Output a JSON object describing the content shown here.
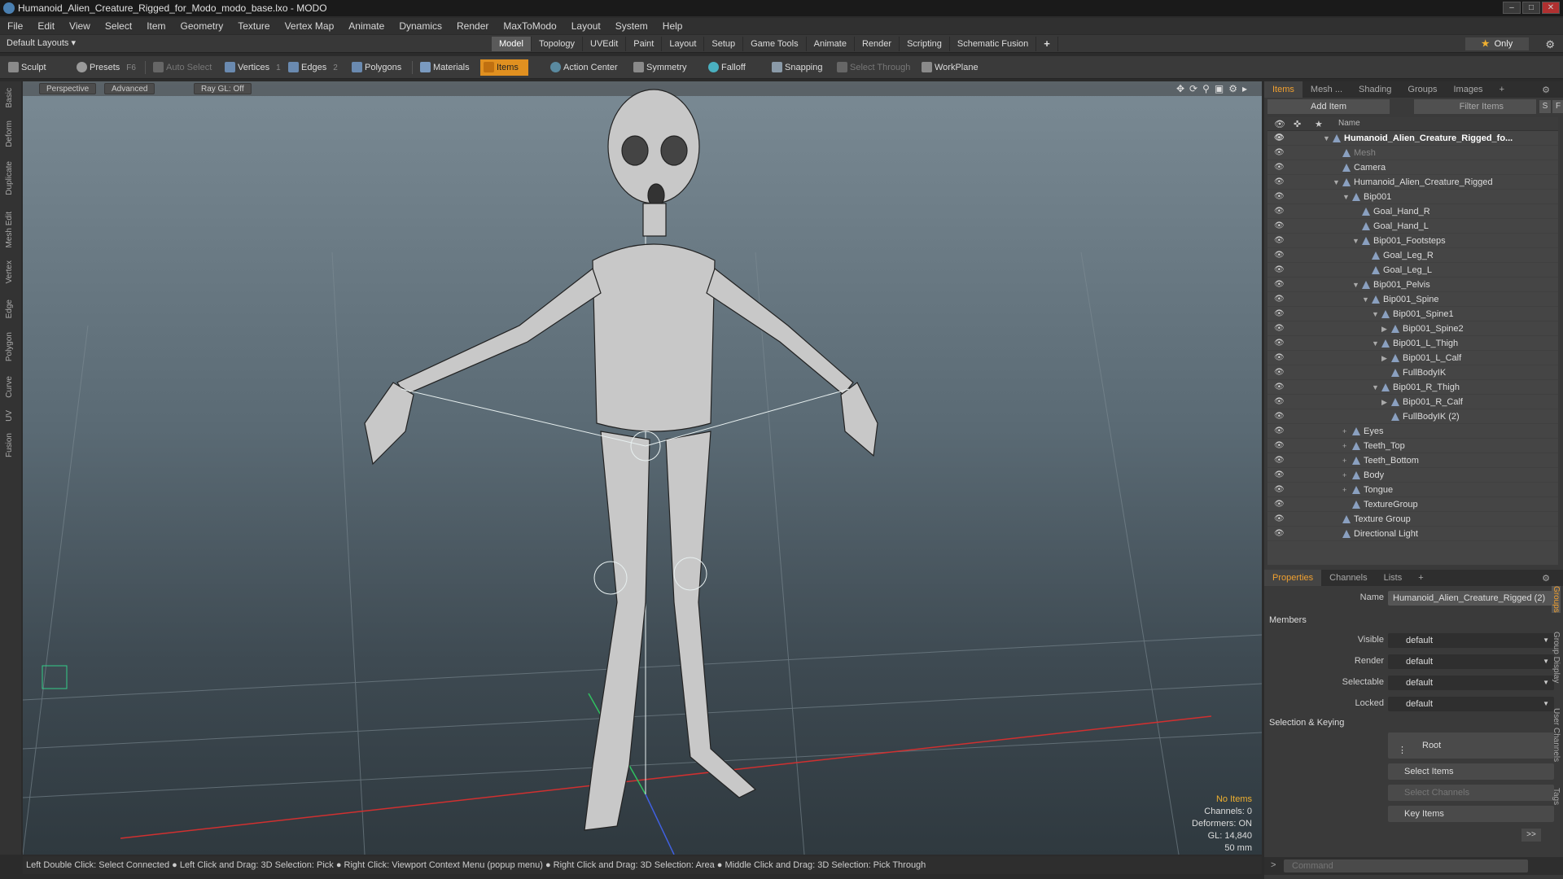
{
  "window": {
    "title": "Humanoid_Alien_Creature_Rigged_for_Modo_modo_base.lxo - MODO"
  },
  "menu": [
    "File",
    "Edit",
    "View",
    "Select",
    "Item",
    "Geometry",
    "Texture",
    "Vertex Map",
    "Animate",
    "Dynamics",
    "Render",
    "MaxToModo",
    "Layout",
    "System",
    "Help"
  ],
  "layouts": {
    "label": "Default Layouts ▾"
  },
  "mode_tabs": [
    "Model",
    "Topology",
    "UVEdit",
    "Paint",
    "Layout",
    "Setup",
    "Game Tools",
    "Animate",
    "Render",
    "Scripting",
    "Schematic Fusion",
    "+"
  ],
  "only_label": "Only",
  "toolbar": {
    "sculpt": "Sculpt",
    "presets": "Presets",
    "presets_key": "F6",
    "auto_select": "Auto Select",
    "vertices": "Vertices",
    "vertices_count": "1",
    "edges": "Edges",
    "edges_count": "2",
    "polygons": "Polygons",
    "materials": "Materials",
    "items": "Items",
    "action_center": "Action Center",
    "symmetry": "Symmetry",
    "falloff": "Falloff",
    "snapping": "Snapping",
    "select_through": "Select Through",
    "workplane": "WorkPlane"
  },
  "left_tabs": [
    "Basic",
    "Deform",
    "Duplicate",
    "Mesh Edit",
    "Vertex",
    "Edge",
    "Polygon",
    "Curve",
    "UV",
    "Fusion"
  ],
  "viewport": {
    "perspective": "Perspective",
    "advanced": "Advanced",
    "raygl": "Ray GL: Off",
    "stats": {
      "no_items": "No Items",
      "channels": "Channels: 0",
      "deformers": "Deformers: ON",
      "gl": "GL: 14,840",
      "focal": "50 mm"
    }
  },
  "status_bar": "Left Double Click: Select Connected ● Left Click and Drag: 3D Selection: Pick ● Right Click: Viewport Context Menu (popup menu) ● Right Click and Drag: 3D Selection: Area ● Middle Click and Drag: 3D Selection: Pick Through",
  "items_panel": {
    "tabs": [
      "Items",
      "Mesh ...",
      "Shading",
      "Groups",
      "Images",
      "+"
    ],
    "add_item": "Add Item",
    "filter_items": "Filter Items",
    "s_btn": "S",
    "f_btn": "F",
    "col_name": "Name",
    "rows": [
      {
        "label": "Humanoid_Alien_Creature_Rigged_fo...",
        "style": "bold",
        "indent": 0,
        "toggle": "▼"
      },
      {
        "label": "Mesh",
        "style": "dim",
        "indent": 1,
        "toggle": ""
      },
      {
        "label": "Camera",
        "style": "",
        "indent": 1,
        "toggle": ""
      },
      {
        "label": "Humanoid_Alien_Creature_Rigged",
        "style": "",
        "indent": 1,
        "toggle": "▼"
      },
      {
        "label": "Bip001",
        "style": "",
        "indent": 2,
        "toggle": "▼"
      },
      {
        "label": "Goal_Hand_R",
        "style": "",
        "indent": 3,
        "toggle": ""
      },
      {
        "label": "Goal_Hand_L",
        "style": "",
        "indent": 3,
        "toggle": ""
      },
      {
        "label": "Bip001_Footsteps",
        "style": "",
        "indent": 3,
        "toggle": "▼"
      },
      {
        "label": "Goal_Leg_R",
        "style": "",
        "indent": 4,
        "toggle": ""
      },
      {
        "label": "Goal_Leg_L",
        "style": "",
        "indent": 4,
        "toggle": ""
      },
      {
        "label": "Bip001_Pelvis",
        "style": "",
        "indent": 3,
        "toggle": "▼"
      },
      {
        "label": "Bip001_Spine",
        "style": "",
        "indent": 4,
        "toggle": "▼"
      },
      {
        "label": "Bip001_Spine1",
        "style": "",
        "indent": 5,
        "toggle": "▼"
      },
      {
        "label": "Bip001_Spine2",
        "style": "",
        "indent": 6,
        "toggle": "▶"
      },
      {
        "label": "Bip001_L_Thigh",
        "style": "",
        "indent": 5,
        "toggle": "▼"
      },
      {
        "label": "Bip001_L_Calf",
        "style": "",
        "indent": 6,
        "toggle": "▶"
      },
      {
        "label": "FullBodyIK",
        "style": "",
        "indent": 6,
        "toggle": ""
      },
      {
        "label": "Bip001_R_Thigh",
        "style": "",
        "indent": 5,
        "toggle": "▼"
      },
      {
        "label": "Bip001_R_Calf",
        "style": "",
        "indent": 6,
        "toggle": "▶"
      },
      {
        "label": "FullBodyIK (2)",
        "style": "",
        "indent": 6,
        "toggle": ""
      },
      {
        "label": "Eyes",
        "style": "",
        "indent": 2,
        "toggle": "+"
      },
      {
        "label": "Teeth_Top",
        "style": "",
        "indent": 2,
        "toggle": "+"
      },
      {
        "label": "Teeth_Bottom",
        "style": "",
        "indent": 2,
        "toggle": "+"
      },
      {
        "label": "Body",
        "style": "",
        "indent": 2,
        "toggle": "+"
      },
      {
        "label": "Tongue",
        "style": "",
        "indent": 2,
        "toggle": "+"
      },
      {
        "label": "TextureGroup",
        "style": "",
        "indent": 2,
        "toggle": ""
      },
      {
        "label": "Texture Group",
        "style": "",
        "indent": 1,
        "toggle": ""
      },
      {
        "label": "Directional Light",
        "style": "",
        "indent": 1,
        "toggle": ""
      }
    ]
  },
  "properties": {
    "tabs": [
      "Properties",
      "Channels",
      "Lists",
      "+"
    ],
    "name_label": "Name",
    "name_value": "Humanoid_Alien_Creature_Rigged (2)",
    "members_label": "Members",
    "visible_label": "Visible",
    "visible_value": "default",
    "render_label": "Render",
    "render_value": "default",
    "selectable_label": "Selectable",
    "selectable_value": "default",
    "locked_label": "Locked",
    "locked_value": "default",
    "selkey_label": "Selection & Keying",
    "root": "Root",
    "select_items": "Select Items",
    "select_channels": "Select Channels",
    "key_items": "Key Items",
    "more": ">>",
    "side_tabs": [
      "Groups",
      "Group Display",
      "User Channels",
      "Tags"
    ]
  },
  "command": {
    "placeholder": "Command"
  },
  "colors": {
    "accent": "#e09020",
    "background": "#2b2b2b"
  }
}
